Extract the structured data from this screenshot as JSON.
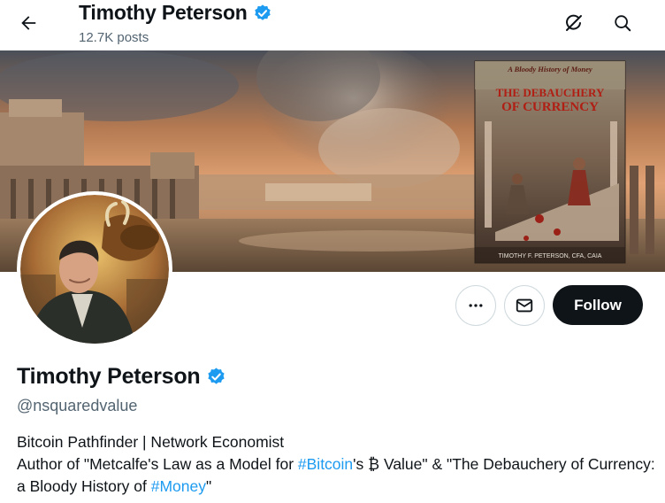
{
  "header": {
    "name": "Timothy Peterson",
    "posts": "12.7K posts"
  },
  "banner": {
    "book_subtitle": "A Bloody History of Money",
    "book_title_line1": "THE DEBAUCHERY",
    "book_title_line2": "OF CURRENCY",
    "book_author": "TIMOTHY F. PETERSON, CFA, CAIA"
  },
  "actions": {
    "follow_label": "Follow"
  },
  "profile": {
    "name": "Timothy Peterson",
    "handle": "@nsquaredvalue",
    "bio_line1": "Bitcoin Pathfinder | Network Economist",
    "bio_part1": "Author of \"Metcalfe's Law as a Model for ",
    "bio_tag1": "#Bitcoin",
    "bio_part2": "'s  ₿ Value\" & \"The Debauchery of Currency: a Bloody History of ",
    "bio_tag2": "#Money",
    "bio_part3": "\""
  },
  "colors": {
    "verified_badge": "#1d9bf0",
    "follow_bg": "#0f1419",
    "link": "#1d9bf0",
    "muted_text": "#536471"
  },
  "icons": {
    "back": "arrow-left-icon",
    "top1": "satellite-icon",
    "top2": "search-icon",
    "more": "more-icon",
    "message": "envelope-icon",
    "verified": "verified-badge-icon"
  }
}
